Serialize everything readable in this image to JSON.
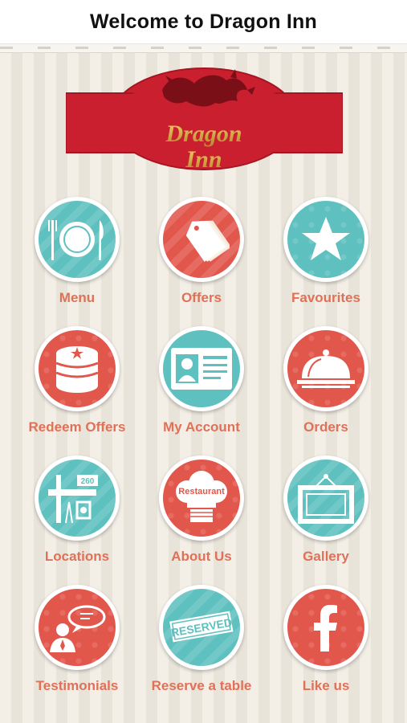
{
  "header": {
    "title": "Welcome to Dragon Inn"
  },
  "logo": {
    "line1": "Dragon",
    "line2": "Inn"
  },
  "colors": {
    "teal": "#5fc1bf",
    "red": "#e2574c",
    "label": "#e07057",
    "banner": "#c5202f"
  },
  "tiles": [
    {
      "label": "Menu",
      "icon": "plate-cutlery-icon"
    },
    {
      "label": "Offers",
      "icon": "price-tags-icon"
    },
    {
      "label": "Favourites",
      "icon": "star-icon"
    },
    {
      "label": "Redeem Offers",
      "icon": "coin-stack-icon"
    },
    {
      "label": "My Account",
      "icon": "id-card-icon"
    },
    {
      "label": "Orders",
      "icon": "cloche-icon"
    },
    {
      "label": "Locations",
      "icon": "street-sign-icon"
    },
    {
      "label": "About Us",
      "icon": "chef-hat-icon"
    },
    {
      "label": "Gallery",
      "icon": "picture-frame-icon"
    },
    {
      "label": "Testimonials",
      "icon": "speech-person-icon"
    },
    {
      "label": "Reserve a table",
      "icon": "reserved-sign-icon"
    },
    {
      "label": "Like us",
      "icon": "facebook-icon"
    }
  ],
  "icon_text": {
    "chef_hat": "Restaurant",
    "reserved": "RESERVED",
    "sign_number": "260"
  }
}
